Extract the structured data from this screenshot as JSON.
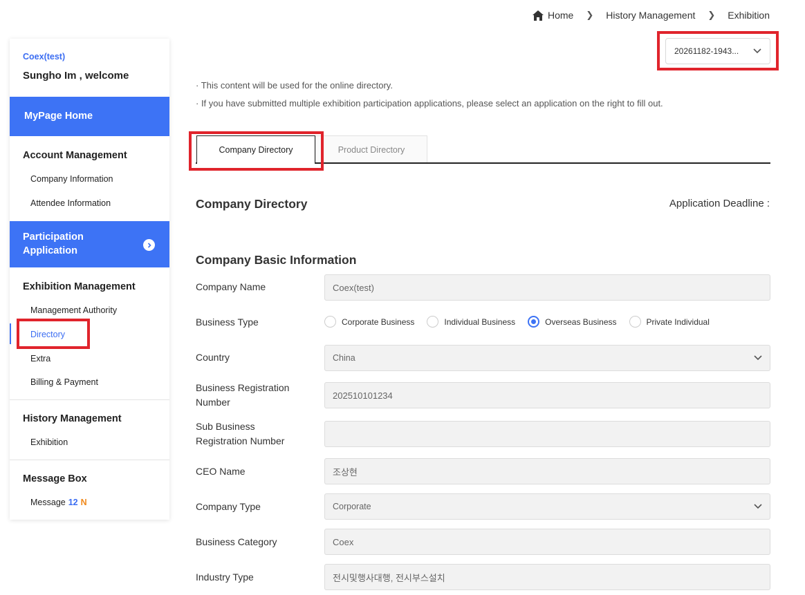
{
  "breadcrumb": {
    "home": "Home",
    "level1": "History Management",
    "level2": "Exhibition"
  },
  "application_select": {
    "value": "20261182-1943..."
  },
  "sidebar": {
    "company": "Coex(test)",
    "welcome": "Sungho Im , welcome",
    "mypage_home": "MyPage Home",
    "account_management": {
      "title": "Account Management",
      "items": [
        "Company Information",
        "Attendee Information"
      ]
    },
    "participation_application": {
      "line1": "Participation",
      "line2": "Application"
    },
    "exhibition_management": {
      "title": "Exhibition Management",
      "items": [
        "Management Authority",
        "Directory",
        "Extra",
        "Billing & Payment"
      ]
    },
    "history_management": {
      "title": "History Management",
      "items": [
        "Exhibition"
      ]
    },
    "message_box": {
      "title": "Message Box",
      "item": "Message",
      "count": "12",
      "new_badge": "N"
    }
  },
  "notices": [
    "· This content will be used for the online directory.",
    "· If you have submitted multiple exhibition participation applications, please select an application on the right to fill out."
  ],
  "tabs": [
    {
      "label": "Company Directory",
      "active": true
    },
    {
      "label": "Product Directory",
      "active": false
    }
  ],
  "section": {
    "title": "Company Directory",
    "deadline_label": "Application Deadline :"
  },
  "basic_info": {
    "title": "Company Basic Information",
    "company_name": {
      "label": "Company Name",
      "value": "Coex(test)"
    },
    "business_type": {
      "label": "Business Type",
      "options": [
        "Corporate Business",
        "Individual Business",
        "Overseas Business",
        "Private Individual"
      ],
      "selected": "Overseas Business"
    },
    "country": {
      "label": "Country",
      "value": "China"
    },
    "brn": {
      "label_line1": "Business Registration",
      "label_line2": "Number",
      "value": "202510101234"
    },
    "sub_brn": {
      "label_line1": "Sub Business",
      "label_line2": "Registration Number",
      "value": ""
    },
    "ceo_name": {
      "label": "CEO Name",
      "value": "조상현"
    },
    "company_type": {
      "label": "Company Type",
      "value": "Corporate"
    },
    "business_category": {
      "label": "Business Category",
      "value": "Coex"
    },
    "industry_type": {
      "label": "Industry Type",
      "value": "전시및행사대행, 전시부스설치"
    }
  },
  "colors": {
    "accent": "#3d73f5",
    "highlight": "#e0242c",
    "badge_new": "#f0891c"
  }
}
